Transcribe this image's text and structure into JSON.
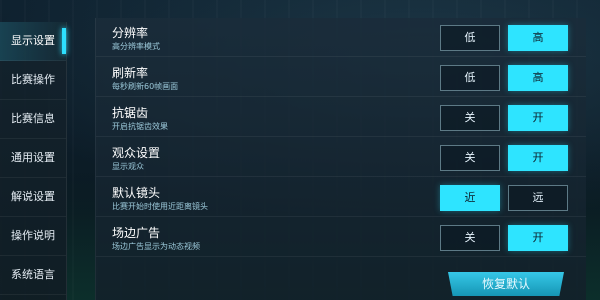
{
  "sidebar": {
    "items": [
      {
        "label": "显示设置",
        "active": true
      },
      {
        "label": "比赛操作"
      },
      {
        "label": "比赛信息"
      },
      {
        "label": "通用设置"
      },
      {
        "label": "解说设置"
      },
      {
        "label": "操作说明"
      },
      {
        "label": "系统语言"
      }
    ]
  },
  "settings": {
    "rows": [
      {
        "title": "分辨率",
        "subtitle": "高分辨率模式",
        "left": "低",
        "right": "高",
        "selected": "right"
      },
      {
        "title": "刷新率",
        "subtitle": "每秒刷新60帧画面",
        "left": "低",
        "right": "高",
        "selected": "right"
      },
      {
        "title": "抗锯齿",
        "subtitle": "开启抗锯齿效果",
        "left": "关",
        "right": "开",
        "selected": "right"
      },
      {
        "title": "观众设置",
        "subtitle": "显示观众",
        "left": "关",
        "right": "开",
        "selected": "right"
      },
      {
        "title": "默认镜头",
        "subtitle": "比赛开始时使用近距离镜头",
        "left": "近",
        "right": "远",
        "selected": "left"
      },
      {
        "title": "场边广告",
        "subtitle": "场边广告显示为动态视频",
        "left": "关",
        "right": "开",
        "selected": "right"
      }
    ],
    "restore_label": "恢复默认"
  },
  "colors": {
    "accent": "#2EE4FF",
    "panel": "#1A2C3A",
    "text": "#FFFFFF",
    "subtext": "#9CC9DA"
  }
}
